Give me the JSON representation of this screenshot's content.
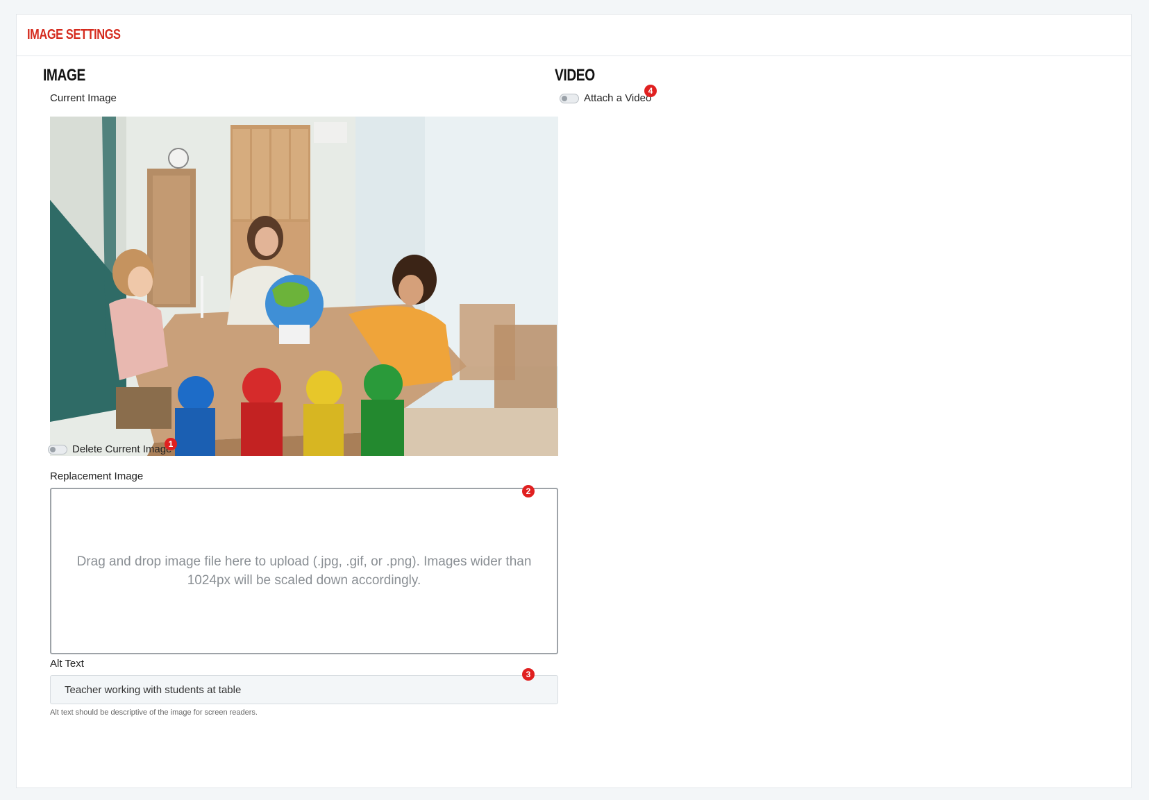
{
  "panel": {
    "title": "IMAGE SETTINGS"
  },
  "image_section": {
    "title": "IMAGE",
    "current_image_label": "Current Image",
    "delete_toggle_label": "Delete Current Image",
    "delete_toggle_on": false,
    "replacement_label": "Replacement Image",
    "dropzone_text": "Drag and drop image file here to upload (.jpg, .gif, or .png). Images wider than 1024px will be scaled down accordingly.",
    "alt_text_label": "Alt Text",
    "alt_text_value": "Teacher working with students at table",
    "alt_text_help": "Alt text should be descriptive of the image for screen readers."
  },
  "video_section": {
    "title": "VIDEO",
    "attach_toggle_label": "Attach a Video",
    "attach_toggle_on": false
  },
  "markers": [
    "1",
    "2",
    "3",
    "4"
  ],
  "colors": {
    "accent": "#d52b1e",
    "marker": "#e02020"
  }
}
